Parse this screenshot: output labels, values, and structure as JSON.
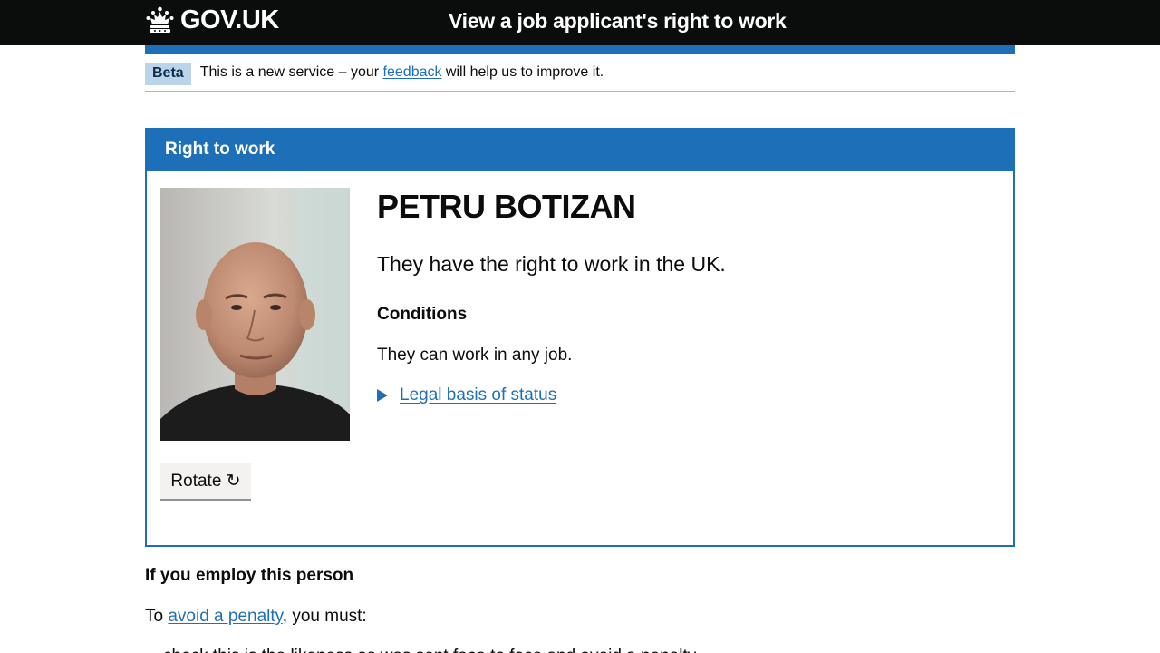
{
  "header": {
    "logo_text": "GOV.UK",
    "service_name": "View a job applicant's right to work"
  },
  "phase_banner": {
    "tag": "Beta",
    "text_before": "This is a new service – your ",
    "link": "feedback",
    "text_after": " will help us to improve it."
  },
  "panel": {
    "title": "Right to work",
    "name": "PETRU BOTIZAN",
    "status": "They have the right to work in the UK.",
    "conditions_heading": "Conditions",
    "conditions_text": "They can work in any job.",
    "details_label": "Legal basis of status",
    "rotate_label": "Rotate ↻"
  },
  "employ": {
    "heading": "If you employ this person",
    "text_before": "To ",
    "link": "avoid a penalty",
    "text_after": ", you must:",
    "list_item": "check this is the likeness as was sent face to face and avoid a penalty"
  },
  "colors": {
    "header_bg": "#0b0c0c",
    "brand_blue": "#1d70b8",
    "tag_bg": "#bbd4ea",
    "button_bg": "#f3f2f1"
  }
}
